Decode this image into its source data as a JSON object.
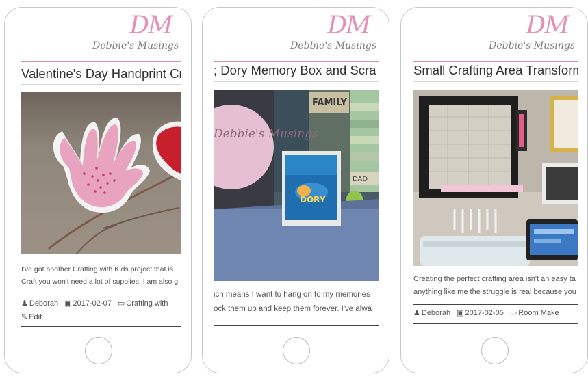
{
  "logo": {
    "initials": "DM",
    "tagline": "Debbie's Musings"
  },
  "posts": [
    {
      "title": "Valentine's Day Handprint Cra",
      "excerpt": [
        "I've got another Crafting with Kids project that is",
        "Craft you won't need a lot of supplies. I am also g"
      ],
      "author": "Deborah",
      "date": "2017-02-07",
      "category": "Crafting with",
      "edit": "Edit"
    },
    {
      "title": "; Dory Memory Box and Scra",
      "image_sign": "Debbie's Musings",
      "image_poster": "DORY",
      "image_wall_label": "FAMILY",
      "image_strip": "DAD",
      "excerpt": [
        "ich means I want to hang on to my memories",
        "ock them up and keep them forever. I've alwa"
      ]
    },
    {
      "title": "Small Crafting Area Transform",
      "excerpt": [
        "Creating the perfect crafting area isn't an easy ta",
        "anything like me the struggle is real because you"
      ],
      "author": "Deborah",
      "date": "2017-02-05",
      "category": "Room Make"
    }
  ],
  "colors": {
    "accent_pink": "#e58fb4",
    "text": "#333333"
  }
}
